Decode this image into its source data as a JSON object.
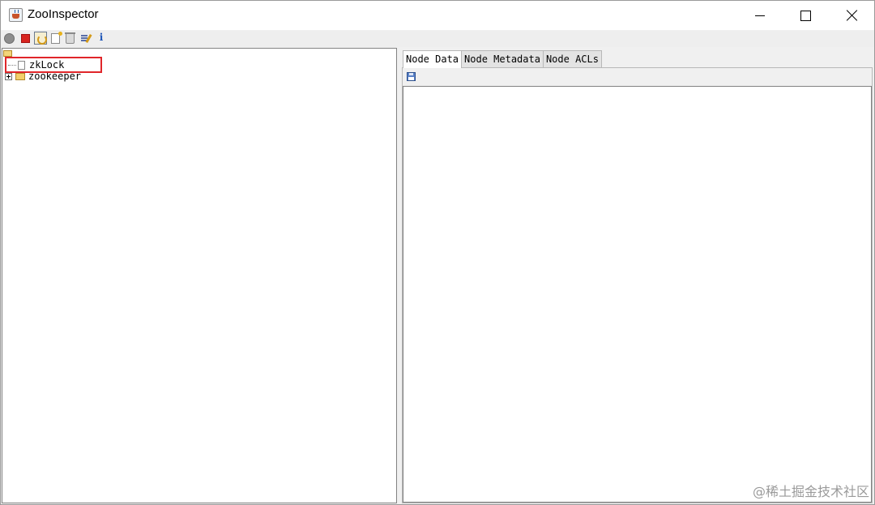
{
  "window": {
    "title": "ZooInspector",
    "controls": {
      "minimize": "minimize-icon",
      "maximize": "maximize-icon",
      "close": "close-icon"
    }
  },
  "toolbar": {
    "icons": [
      "connect-icon",
      "disconnect-icon",
      "refresh-icon",
      "add-node-icon",
      "delete-node-icon",
      "edit-icon",
      "about-icon"
    ],
    "info_glyph": "i"
  },
  "tree": {
    "root_icon": "folder-icon",
    "nodes": [
      {
        "label": "zkLock",
        "icon": "file-icon",
        "expandable": false,
        "highlighted": true
      },
      {
        "label": "zookeeper",
        "icon": "folder-icon",
        "expandable": true
      }
    ],
    "highlight_color": "#e0262a"
  },
  "right_panel": {
    "tabs": [
      "Node Data",
      "Node Metadata",
      "Node ACLs"
    ],
    "active_tab": "Node Data",
    "toolbar_icons": [
      "save-icon"
    ],
    "content": ""
  },
  "watermark": "@稀土掘金技术社区"
}
